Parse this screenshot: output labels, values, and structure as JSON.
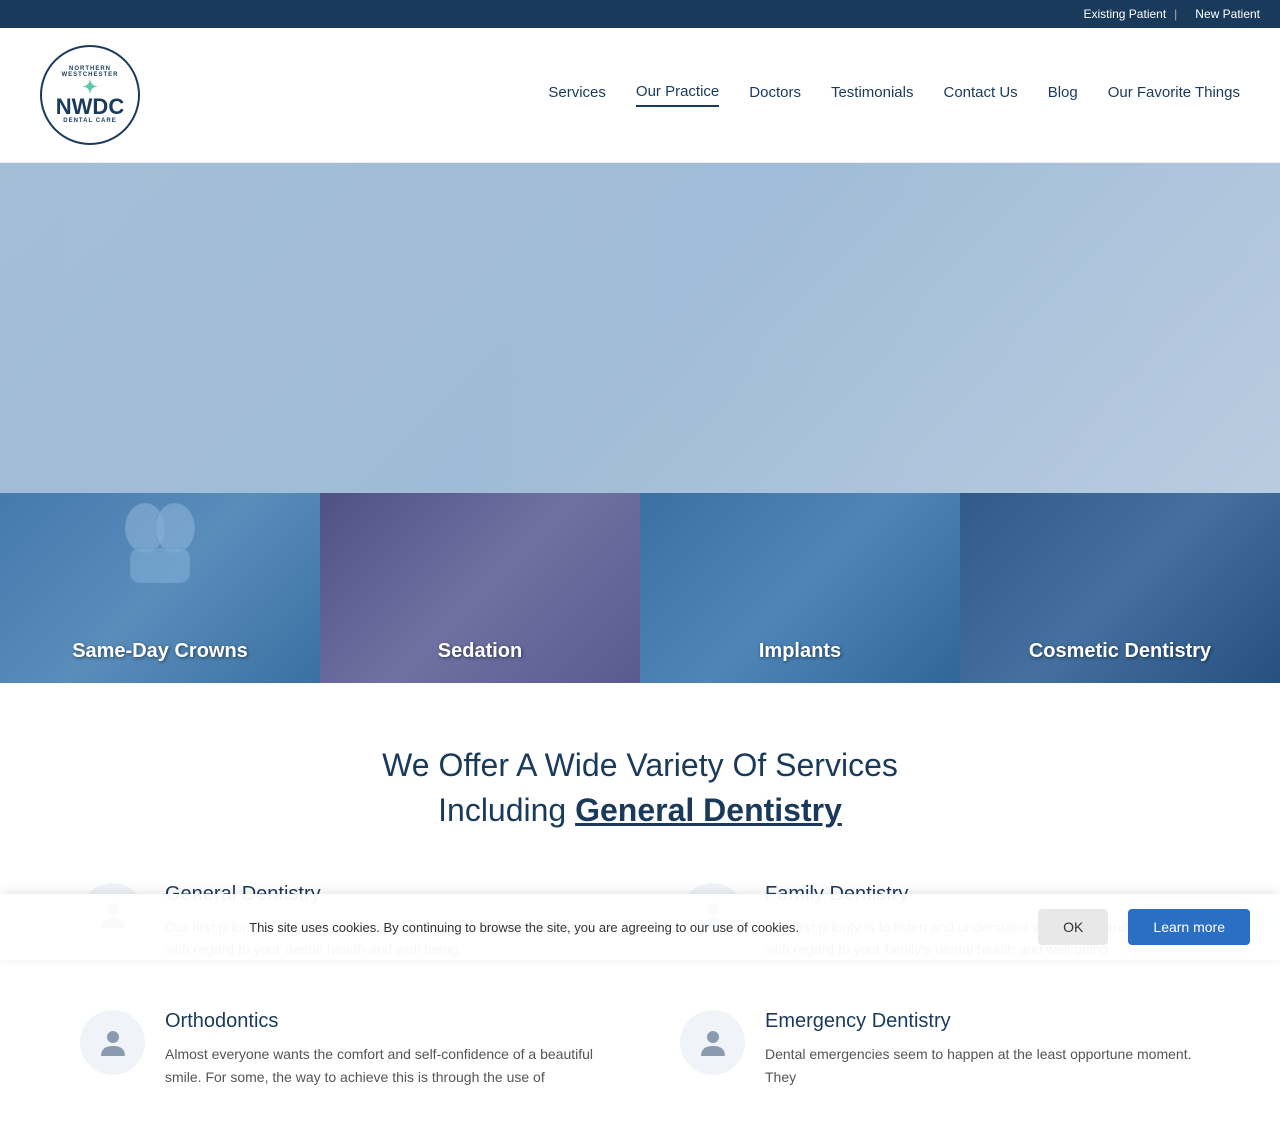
{
  "topbar": {
    "existing_patient": "Existing Patient",
    "new_patient": "New Patient",
    "divider": "|"
  },
  "logo": {
    "top_text": "NORTHERN WESTCHESTER",
    "abbr": "NWDC",
    "bottom_text": "DENTAL CARE",
    "leaf_symbol": "✿"
  },
  "nav": {
    "items": [
      {
        "id": "services",
        "label": "Services",
        "active": false
      },
      {
        "id": "our-practice",
        "label": "Our Practice",
        "active": true
      },
      {
        "id": "doctors",
        "label": "Doctors",
        "active": false
      },
      {
        "id": "testimonials",
        "label": "Testimonials",
        "active": false
      },
      {
        "id": "contact-us",
        "label": "Contact Us",
        "active": false
      },
      {
        "id": "blog",
        "label": "Blog",
        "active": false
      },
      {
        "id": "our-favorite-things",
        "label": "Our Favorite Things",
        "active": false
      }
    ]
  },
  "service_tiles": [
    {
      "id": "same-day-crowns",
      "label": "Same-Day Crowns"
    },
    {
      "id": "sedation",
      "label": "Sedation"
    },
    {
      "id": "implants",
      "label": "Implants"
    },
    {
      "id": "cosmetic-dentistry",
      "label": "Cosmetic Dentistry"
    }
  ],
  "main": {
    "section_title_line1": "We Offer A Wide Variety Of Services",
    "section_title_line2_normal": "Including ",
    "section_title_line2_bold": "General Dentistry",
    "services": [
      {
        "id": "general-dentistry",
        "title": "General Dentistry",
        "description": "Our first priority is to listen and understand your needs and desires with regard to your dental health and well being.",
        "icon": "👤"
      },
      {
        "id": "family-dentistry",
        "title": "Family Dentistry",
        "description": "Our first priority is to listen and understand your needs and desires with regard to your family's dental health and well being.",
        "icon": "👤"
      },
      {
        "id": "orthodontics",
        "title": "Orthodontics",
        "description": "Almost everyone wants the comfort and self-confidence of a beautiful smile. For some, the way to achieve this is through the use of",
        "icon": "👤"
      },
      {
        "id": "emergency-dentistry",
        "title": "Emergency Dentistry",
        "description": "Dental emergencies seem to happen at the least opportune moment. They",
        "icon": "👤"
      }
    ]
  },
  "cookie": {
    "text": "This site uses cookies. By continuing to browse the site, you are agreeing to our use of cookies.",
    "ok_label": "OK",
    "learn_more_label": "Learn more"
  }
}
